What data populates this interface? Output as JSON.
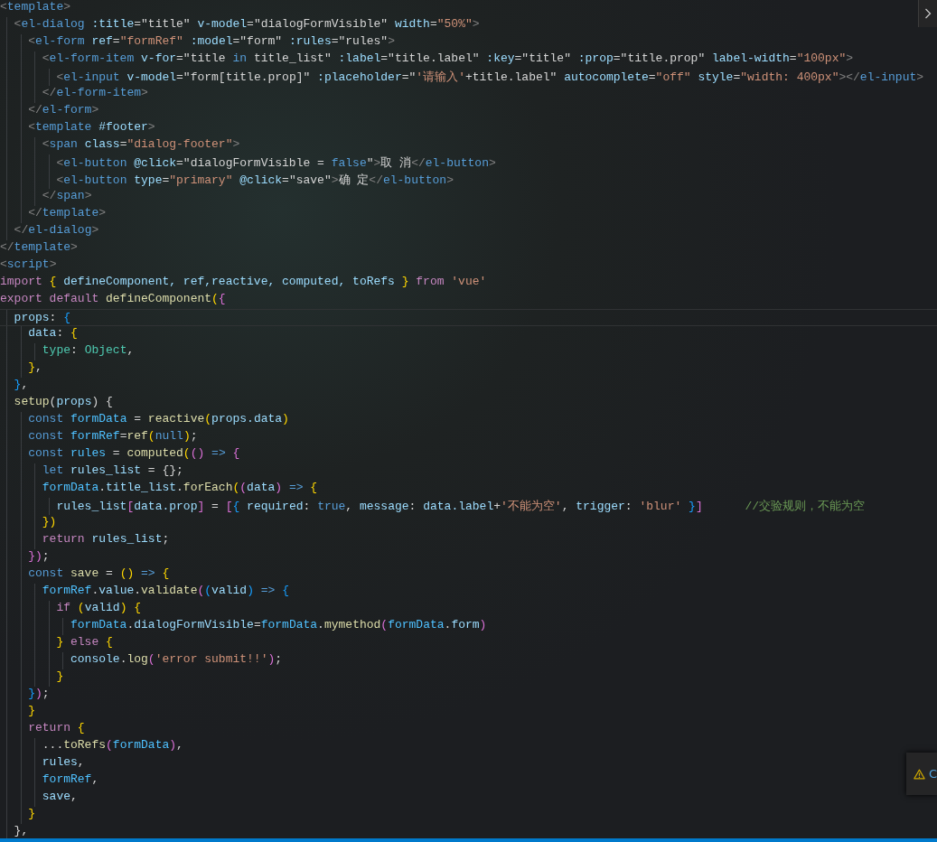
{
  "editor": {
    "lines": [
      {
        "tokens": [
          {
            "kind": "p",
            "text": "<"
          },
          {
            "kind": "tg",
            "text": "template"
          },
          {
            "kind": "p",
            "text": ">"
          }
        ]
      },
      {
        "tokens": [
          {
            "kind": "p",
            "text": "  <"
          },
          {
            "kind": "tg",
            "text": "el-dialog"
          },
          {
            "kind": "at",
            "text": " :title"
          },
          {
            "kind": "x",
            "text": "=\"title\""
          },
          {
            "kind": "at",
            "text": " v-model"
          },
          {
            "kind": "x",
            "text": "=\"dialogFormVisible\""
          },
          {
            "kind": "at",
            "text": " width"
          },
          {
            "kind": "x",
            "text": "="
          },
          {
            "kind": "s",
            "text": "\"50%\""
          },
          {
            "kind": "p",
            "text": ">"
          }
        ]
      },
      {
        "tokens": [
          {
            "kind": "p",
            "text": "    <"
          },
          {
            "kind": "tg",
            "text": "el-form"
          },
          {
            "kind": "at",
            "text": " ref"
          },
          {
            "kind": "x",
            "text": "="
          },
          {
            "kind": "s",
            "text": "\"formRef\""
          },
          {
            "kind": "at",
            "text": " :model"
          },
          {
            "kind": "x",
            "text": "=\"form\""
          },
          {
            "kind": "at",
            "text": " :rules"
          },
          {
            "kind": "x",
            "text": "=\"rules\""
          },
          {
            "kind": "p",
            "text": ">"
          }
        ]
      },
      {
        "tokens": [
          {
            "kind": "p",
            "text": "      <"
          },
          {
            "kind": "tg",
            "text": "el-form-item"
          },
          {
            "kind": "at",
            "text": " v-for"
          },
          {
            "kind": "x",
            "text": "=\"title "
          },
          {
            "kind": "b",
            "text": "in"
          },
          {
            "kind": "x",
            "text": " title_list\""
          },
          {
            "kind": "at",
            "text": " :label"
          },
          {
            "kind": "x",
            "text": "=\"title.label\""
          },
          {
            "kind": "at",
            "text": " :key"
          },
          {
            "kind": "x",
            "text": "=\"title\""
          },
          {
            "kind": "at",
            "text": " :prop"
          },
          {
            "kind": "x",
            "text": "=\"title.prop\""
          },
          {
            "kind": "at",
            "text": " label-width"
          },
          {
            "kind": "x",
            "text": "="
          },
          {
            "kind": "s",
            "text": "\"100px\""
          },
          {
            "kind": "p",
            "text": ">"
          }
        ]
      },
      {
        "tokens": [
          {
            "kind": "p",
            "text": "        <"
          },
          {
            "kind": "tg",
            "text": "el-input"
          },
          {
            "kind": "at",
            "text": " v-model"
          },
          {
            "kind": "x",
            "text": "=\"form[title.prop]\""
          },
          {
            "kind": "at",
            "text": " :placeholder"
          },
          {
            "kind": "x",
            "text": "=\""
          },
          {
            "kind": "s",
            "text": "'请输入'"
          },
          {
            "kind": "x",
            "text": "+title.label\""
          },
          {
            "kind": "at",
            "text": " autocomplete"
          },
          {
            "kind": "x",
            "text": "="
          },
          {
            "kind": "s",
            "text": "\"off\""
          },
          {
            "kind": "at",
            "text": " style"
          },
          {
            "kind": "x",
            "text": "="
          },
          {
            "kind": "s",
            "text": "\"width: 400px\""
          },
          {
            "kind": "p",
            "text": "></"
          },
          {
            "kind": "tg",
            "text": "el-input"
          },
          {
            "kind": "p",
            "text": ">"
          }
        ]
      },
      {
        "tokens": [
          {
            "kind": "p",
            "text": "      </"
          },
          {
            "kind": "tg",
            "text": "el-form-item"
          },
          {
            "kind": "p",
            "text": ">"
          }
        ]
      },
      {
        "tokens": [
          {
            "kind": "p",
            "text": "    </"
          },
          {
            "kind": "tg",
            "text": "el-form"
          },
          {
            "kind": "p",
            "text": ">"
          }
        ]
      },
      {
        "tokens": [
          {
            "kind": "p",
            "text": "    <"
          },
          {
            "kind": "tg",
            "text": "template"
          },
          {
            "kind": "at",
            "text": " #footer"
          },
          {
            "kind": "p",
            "text": ">"
          }
        ]
      },
      {
        "tokens": [
          {
            "kind": "p",
            "text": "      <"
          },
          {
            "kind": "tg",
            "text": "span"
          },
          {
            "kind": "at",
            "text": " class"
          },
          {
            "kind": "x",
            "text": "="
          },
          {
            "kind": "s",
            "text": "\"dialog-footer\""
          },
          {
            "kind": "p",
            "text": ">"
          }
        ]
      },
      {
        "tokens": [
          {
            "kind": "p",
            "text": "        <"
          },
          {
            "kind": "tg",
            "text": "el-button"
          },
          {
            "kind": "at",
            "text": " @click"
          },
          {
            "kind": "x",
            "text": "=\"dialogFormVisible = "
          },
          {
            "kind": "b",
            "text": "false"
          },
          {
            "kind": "x",
            "text": "\""
          },
          {
            "kind": "p",
            "text": ">"
          },
          {
            "kind": "x",
            "text": "取 消"
          },
          {
            "kind": "p",
            "text": "</"
          },
          {
            "kind": "tg",
            "text": "el-button"
          },
          {
            "kind": "p",
            "text": ">"
          }
        ]
      },
      {
        "tokens": [
          {
            "kind": "p",
            "text": "        <"
          },
          {
            "kind": "tg",
            "text": "el-button"
          },
          {
            "kind": "at",
            "text": " type"
          },
          {
            "kind": "x",
            "text": "="
          },
          {
            "kind": "s",
            "text": "\"primary\""
          },
          {
            "kind": "at",
            "text": " @click"
          },
          {
            "kind": "x",
            "text": "=\"save\""
          },
          {
            "kind": "p",
            "text": ">"
          },
          {
            "kind": "x",
            "text": "确 定"
          },
          {
            "kind": "p",
            "text": "</"
          },
          {
            "kind": "tg",
            "text": "el-button"
          },
          {
            "kind": "p",
            "text": ">"
          }
        ]
      },
      {
        "tokens": [
          {
            "kind": "p",
            "text": "      </"
          },
          {
            "kind": "tg",
            "text": "span"
          },
          {
            "kind": "p",
            "text": ">"
          }
        ]
      },
      {
        "tokens": [
          {
            "kind": "p",
            "text": "    </"
          },
          {
            "kind": "tg",
            "text": "template"
          },
          {
            "kind": "p",
            "text": ">"
          }
        ]
      },
      {
        "tokens": [
          {
            "kind": "p",
            "text": "  </"
          },
          {
            "kind": "tg",
            "text": "el-dialog"
          },
          {
            "kind": "p",
            "text": ">"
          }
        ]
      },
      {
        "tokens": [
          {
            "kind": "p",
            "text": "</"
          },
          {
            "kind": "tg",
            "text": "template"
          },
          {
            "kind": "p",
            "text": ">"
          }
        ]
      },
      {
        "tokens": [
          {
            "kind": "p",
            "text": "<"
          },
          {
            "kind": "tg",
            "text": "script"
          },
          {
            "kind": "p",
            "text": ">"
          }
        ]
      },
      {
        "tokens": [
          {
            "kind": "k",
            "text": "import"
          },
          {
            "kind": "y",
            "text": " {"
          },
          {
            "kind": "v",
            "text": " defineComponent, ref,reactive, computed, toRefs "
          },
          {
            "kind": "y",
            "text": "}"
          },
          {
            "kind": "k",
            "text": " from"
          },
          {
            "kind": "s",
            "text": " 'vue'"
          }
        ]
      },
      {
        "tokens": [
          {
            "kind": "k",
            "text": "export default"
          },
          {
            "kind": "f",
            "text": " defineComponent"
          },
          {
            "kind": "y",
            "text": "("
          },
          {
            "kind": "pk",
            "text": "{"
          }
        ]
      },
      {
        "current": true,
        "tokens": [
          {
            "kind": "v",
            "text": "  props"
          },
          {
            "kind": "x",
            "text": ": "
          },
          {
            "kind": "bl",
            "text": "{"
          }
        ]
      },
      {
        "tokens": [
          {
            "kind": "v",
            "text": "    data"
          },
          {
            "kind": "x",
            "text": ": "
          },
          {
            "kind": "y",
            "text": "{"
          }
        ]
      },
      {
        "tokens": [
          {
            "kind": "t",
            "text": "      type"
          },
          {
            "kind": "x",
            "text": ": "
          },
          {
            "kind": "t",
            "text": "Object"
          },
          {
            "kind": "x",
            "text": ","
          }
        ]
      },
      {
        "tokens": [
          {
            "kind": "y",
            "text": "    }"
          },
          {
            "kind": "x",
            "text": ","
          }
        ]
      },
      {
        "tokens": [
          {
            "kind": "bl",
            "text": "  }"
          },
          {
            "kind": "x",
            "text": ","
          }
        ]
      },
      {
        "tokens": [
          {
            "kind": "f",
            "text": "  setup"
          },
          {
            "kind": "x",
            "text": "("
          },
          {
            "kind": "v",
            "text": "props"
          },
          {
            "kind": "x",
            "text": ") {"
          }
        ]
      },
      {
        "tokens": [
          {
            "kind": "b",
            "text": "    const"
          },
          {
            "kind": "c",
            "text": " formData"
          },
          {
            "kind": "x",
            "text": " = "
          },
          {
            "kind": "f",
            "text": "reactive"
          },
          {
            "kind": "y",
            "text": "("
          },
          {
            "kind": "v",
            "text": "props.data"
          },
          {
            "kind": "y",
            "text": ")"
          }
        ]
      },
      {
        "tokens": [
          {
            "kind": "b",
            "text": "    const"
          },
          {
            "kind": "c",
            "text": " formRef"
          },
          {
            "kind": "x",
            "text": "="
          },
          {
            "kind": "f",
            "text": "ref"
          },
          {
            "kind": "y",
            "text": "("
          },
          {
            "kind": "b",
            "text": "null"
          },
          {
            "kind": "y",
            "text": ")"
          },
          {
            "kind": "x",
            "text": ";"
          }
        ]
      },
      {
        "tokens": [
          {
            "kind": "b",
            "text": "    const"
          },
          {
            "kind": "c",
            "text": " rules"
          },
          {
            "kind": "x",
            "text": " = "
          },
          {
            "kind": "f",
            "text": "computed"
          },
          {
            "kind": "y",
            "text": "("
          },
          {
            "kind": "pk",
            "text": "()"
          },
          {
            "kind": "b",
            "text": " =>"
          },
          {
            "kind": "pk",
            "text": " {"
          }
        ]
      },
      {
        "tokens": [
          {
            "kind": "b",
            "text": "      let"
          },
          {
            "kind": "v",
            "text": " rules_list"
          },
          {
            "kind": "x",
            "text": " = {};"
          }
        ]
      },
      {
        "tokens": [
          {
            "kind": "c",
            "text": "      formData"
          },
          {
            "kind": "x",
            "text": "."
          },
          {
            "kind": "v",
            "text": "title_list"
          },
          {
            "kind": "x",
            "text": "."
          },
          {
            "kind": "f",
            "text": "forEach"
          },
          {
            "kind": "y",
            "text": "("
          },
          {
            "kind": "pk",
            "text": "("
          },
          {
            "kind": "v",
            "text": "data"
          },
          {
            "kind": "pk",
            "text": ")"
          },
          {
            "kind": "b",
            "text": " =>"
          },
          {
            "kind": "y",
            "text": " {"
          }
        ]
      },
      {
        "tokens": [
          {
            "kind": "v",
            "text": "        rules_list"
          },
          {
            "kind": "pk",
            "text": "["
          },
          {
            "kind": "v",
            "text": "data.prop"
          },
          {
            "kind": "pk",
            "text": "]"
          },
          {
            "kind": "x",
            "text": " = "
          },
          {
            "kind": "pk",
            "text": "["
          },
          {
            "kind": "bl",
            "text": "{"
          },
          {
            "kind": "v",
            "text": " required"
          },
          {
            "kind": "x",
            "text": ": "
          },
          {
            "kind": "b",
            "text": "true"
          },
          {
            "kind": "x",
            "text": ", "
          },
          {
            "kind": "v",
            "text": "message"
          },
          {
            "kind": "x",
            "text": ": "
          },
          {
            "kind": "v",
            "text": "data.label"
          },
          {
            "kind": "x",
            "text": "+"
          },
          {
            "kind": "s",
            "text": "'不能为空'"
          },
          {
            "kind": "x",
            "text": ", "
          },
          {
            "kind": "v",
            "text": "trigger"
          },
          {
            "kind": "x",
            "text": ": "
          },
          {
            "kind": "s",
            "text": "'blur'"
          },
          {
            "kind": "bl",
            "text": " }"
          },
          {
            "kind": "pk",
            "text": "]"
          },
          {
            "kind": "m",
            "text": "      //交验规则，不能为空"
          }
        ]
      },
      {
        "tokens": [
          {
            "kind": "y",
            "text": "      })"
          }
        ]
      },
      {
        "tokens": [
          {
            "kind": "k",
            "text": "      return"
          },
          {
            "kind": "v",
            "text": " rules_list"
          },
          {
            "kind": "x",
            "text": ";"
          }
        ]
      },
      {
        "tokens": [
          {
            "kind": "pk",
            "text": "    })"
          },
          {
            "kind": "x",
            "text": ";"
          }
        ]
      },
      {
        "tokens": [
          {
            "kind": "b",
            "text": "    const"
          },
          {
            "kind": "f",
            "text": " save"
          },
          {
            "kind": "x",
            "text": " = "
          },
          {
            "kind": "y",
            "text": "()"
          },
          {
            "kind": "b",
            "text": " =>"
          },
          {
            "kind": "y",
            "text": " {"
          }
        ]
      },
      {
        "tokens": [
          {
            "kind": "c",
            "text": "      formRef"
          },
          {
            "kind": "x",
            "text": "."
          },
          {
            "kind": "v",
            "text": "value"
          },
          {
            "kind": "x",
            "text": "."
          },
          {
            "kind": "f",
            "text": "validate"
          },
          {
            "kind": "pk",
            "text": "("
          },
          {
            "kind": "bl",
            "text": "("
          },
          {
            "kind": "v",
            "text": "valid"
          },
          {
            "kind": "bl",
            "text": ")"
          },
          {
            "kind": "b",
            "text": " =>"
          },
          {
            "kind": "bl",
            "text": " {"
          }
        ]
      },
      {
        "tokens": [
          {
            "kind": "k",
            "text": "        if"
          },
          {
            "kind": "y",
            "text": " ("
          },
          {
            "kind": "v",
            "text": "valid"
          },
          {
            "kind": "y",
            "text": ")"
          },
          {
            "kind": "y",
            "text": " {"
          }
        ]
      },
      {
        "tokens": [
          {
            "kind": "c",
            "text": "          formData"
          },
          {
            "kind": "x",
            "text": "."
          },
          {
            "kind": "v",
            "text": "dialogFormVisible"
          },
          {
            "kind": "x",
            "text": "="
          },
          {
            "kind": "c",
            "text": "formData"
          },
          {
            "kind": "x",
            "text": "."
          },
          {
            "kind": "f",
            "text": "mymethod"
          },
          {
            "kind": "pk",
            "text": "("
          },
          {
            "kind": "c",
            "text": "formData"
          },
          {
            "kind": "x",
            "text": "."
          },
          {
            "kind": "v",
            "text": "form"
          },
          {
            "kind": "pk",
            "text": ")"
          }
        ]
      },
      {
        "tokens": [
          {
            "kind": "y",
            "text": "        }"
          },
          {
            "kind": "k",
            "text": " else"
          },
          {
            "kind": "y",
            "text": " {"
          }
        ]
      },
      {
        "tokens": [
          {
            "kind": "v",
            "text": "          console"
          },
          {
            "kind": "x",
            "text": "."
          },
          {
            "kind": "f",
            "text": "log"
          },
          {
            "kind": "pk",
            "text": "("
          },
          {
            "kind": "s",
            "text": "'error submit!!'"
          },
          {
            "kind": "pk",
            "text": ")"
          },
          {
            "kind": "x",
            "text": ";"
          }
        ]
      },
      {
        "tokens": [
          {
            "kind": "y",
            "text": "        }"
          }
        ]
      },
      {
        "tokens": [
          {
            "kind": "bl",
            "text": "    }"
          },
          {
            "kind": "pk",
            "text": ")"
          },
          {
            "kind": "x",
            "text": ";"
          }
        ]
      },
      {
        "tokens": [
          {
            "kind": "y",
            "text": "    }"
          }
        ]
      },
      {
        "tokens": [
          {
            "kind": "k",
            "text": "    return"
          },
          {
            "kind": "y",
            "text": " {"
          }
        ]
      },
      {
        "tokens": [
          {
            "kind": "x",
            "text": "      ..."
          },
          {
            "kind": "f",
            "text": "toRefs"
          },
          {
            "kind": "pk",
            "text": "("
          },
          {
            "kind": "c",
            "text": "formData"
          },
          {
            "kind": "pk",
            "text": ")"
          },
          {
            "kind": "x",
            "text": ","
          }
        ]
      },
      {
        "tokens": [
          {
            "kind": "v",
            "text": "      rules"
          },
          {
            "kind": "x",
            "text": ","
          }
        ]
      },
      {
        "tokens": [
          {
            "kind": "c",
            "text": "      formRef"
          },
          {
            "kind": "x",
            "text": ","
          }
        ]
      },
      {
        "tokens": [
          {
            "kind": "v",
            "text": "      save"
          },
          {
            "kind": "x",
            "text": ","
          }
        ]
      },
      {
        "tokens": [
          {
            "kind": "y",
            "text": "    }"
          }
        ]
      },
      {
        "tokens": [
          {
            "kind": "x",
            "text": "  },"
          }
        ]
      }
    ]
  },
  "notification": {
    "text": "C"
  }
}
